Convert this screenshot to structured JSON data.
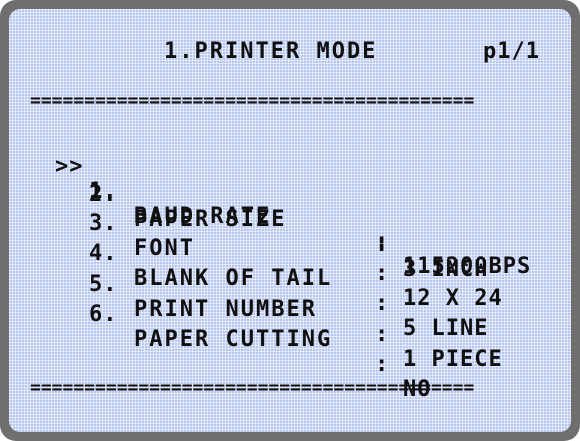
{
  "header": {
    "title": "1.PRINTER MODE",
    "page": "p1/1"
  },
  "divider_text": "=========================================",
  "menu": {
    "cursor": ">>",
    "items": [
      {
        "number": "1.",
        "label": "BAUD RATE",
        "separator": ":",
        "value": "115200BPS"
      },
      {
        "number": "2.",
        "label": "PAPER SIZE",
        "separator": ":",
        "value": "3 INCH"
      },
      {
        "number": "3.",
        "label": "FONT",
        "separator": ":",
        "value": "12 X 24"
      },
      {
        "number": "4.",
        "label": "BLANK OF TAIL",
        "separator": ":",
        "value": "5 LINE"
      },
      {
        "number": "5.",
        "label": "PRINT NUMBER",
        "separator": ":",
        "value": "1 PIECE"
      },
      {
        "number": "6.",
        "label": "PAPER CUTTING",
        "separator": ":",
        "value": "NO"
      }
    ]
  }
}
